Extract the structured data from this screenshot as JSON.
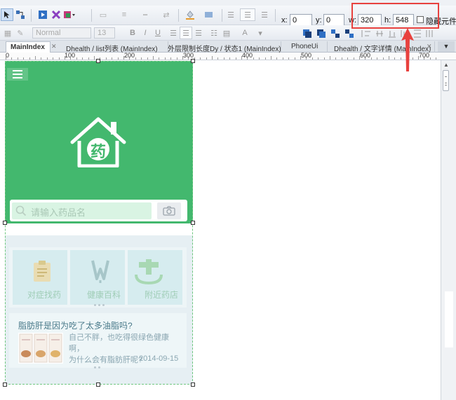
{
  "toolbar": {
    "coords": {
      "x_label": "x:",
      "x": "0",
      "y_label": "y:",
      "y": "0",
      "w_label": "w:",
      "w": "320",
      "h_label": "h:",
      "h": "548"
    },
    "hide_label": "隐藏元件",
    "font_name": "Normal",
    "font_size": "13",
    "bold": "B",
    "italic": "I",
    "underline": "U"
  },
  "tabs": [
    {
      "label": "MainIndex",
      "active": true
    },
    {
      "label": "Dhealth / list列表 (MainIndex)"
    },
    {
      "label": "外层限制长度Dy / 状态1 (MainIndex)"
    },
    {
      "label": "PhoneUi"
    },
    {
      "label": "Dhealth / 文字详情 (MainIndex)"
    }
  ],
  "ruler": [
    "0",
    "100",
    "200",
    "300",
    "400",
    "500",
    "600",
    "700"
  ],
  "app": {
    "logo_char": "药",
    "search_placeholder": "请输入药品名",
    "categories": [
      {
        "label": "对症找药",
        "icon": "clipboard-icon"
      },
      {
        "label": "健康百科",
        "icon": "wheat-icon"
      },
      {
        "label": "附近药店",
        "icon": "pharmacy-icon"
      }
    ],
    "news": {
      "title": "脂肪肝是因为吃了太多油脂吗?",
      "desc1": "自己不胖，也吃得很绿色健康啊，",
      "desc2": "为什么会有脂肪肝呢?",
      "date": "2014-09-15"
    }
  },
  "colors": {
    "brand_green": "#43b86e",
    "highlight_red": "#e8413e"
  }
}
